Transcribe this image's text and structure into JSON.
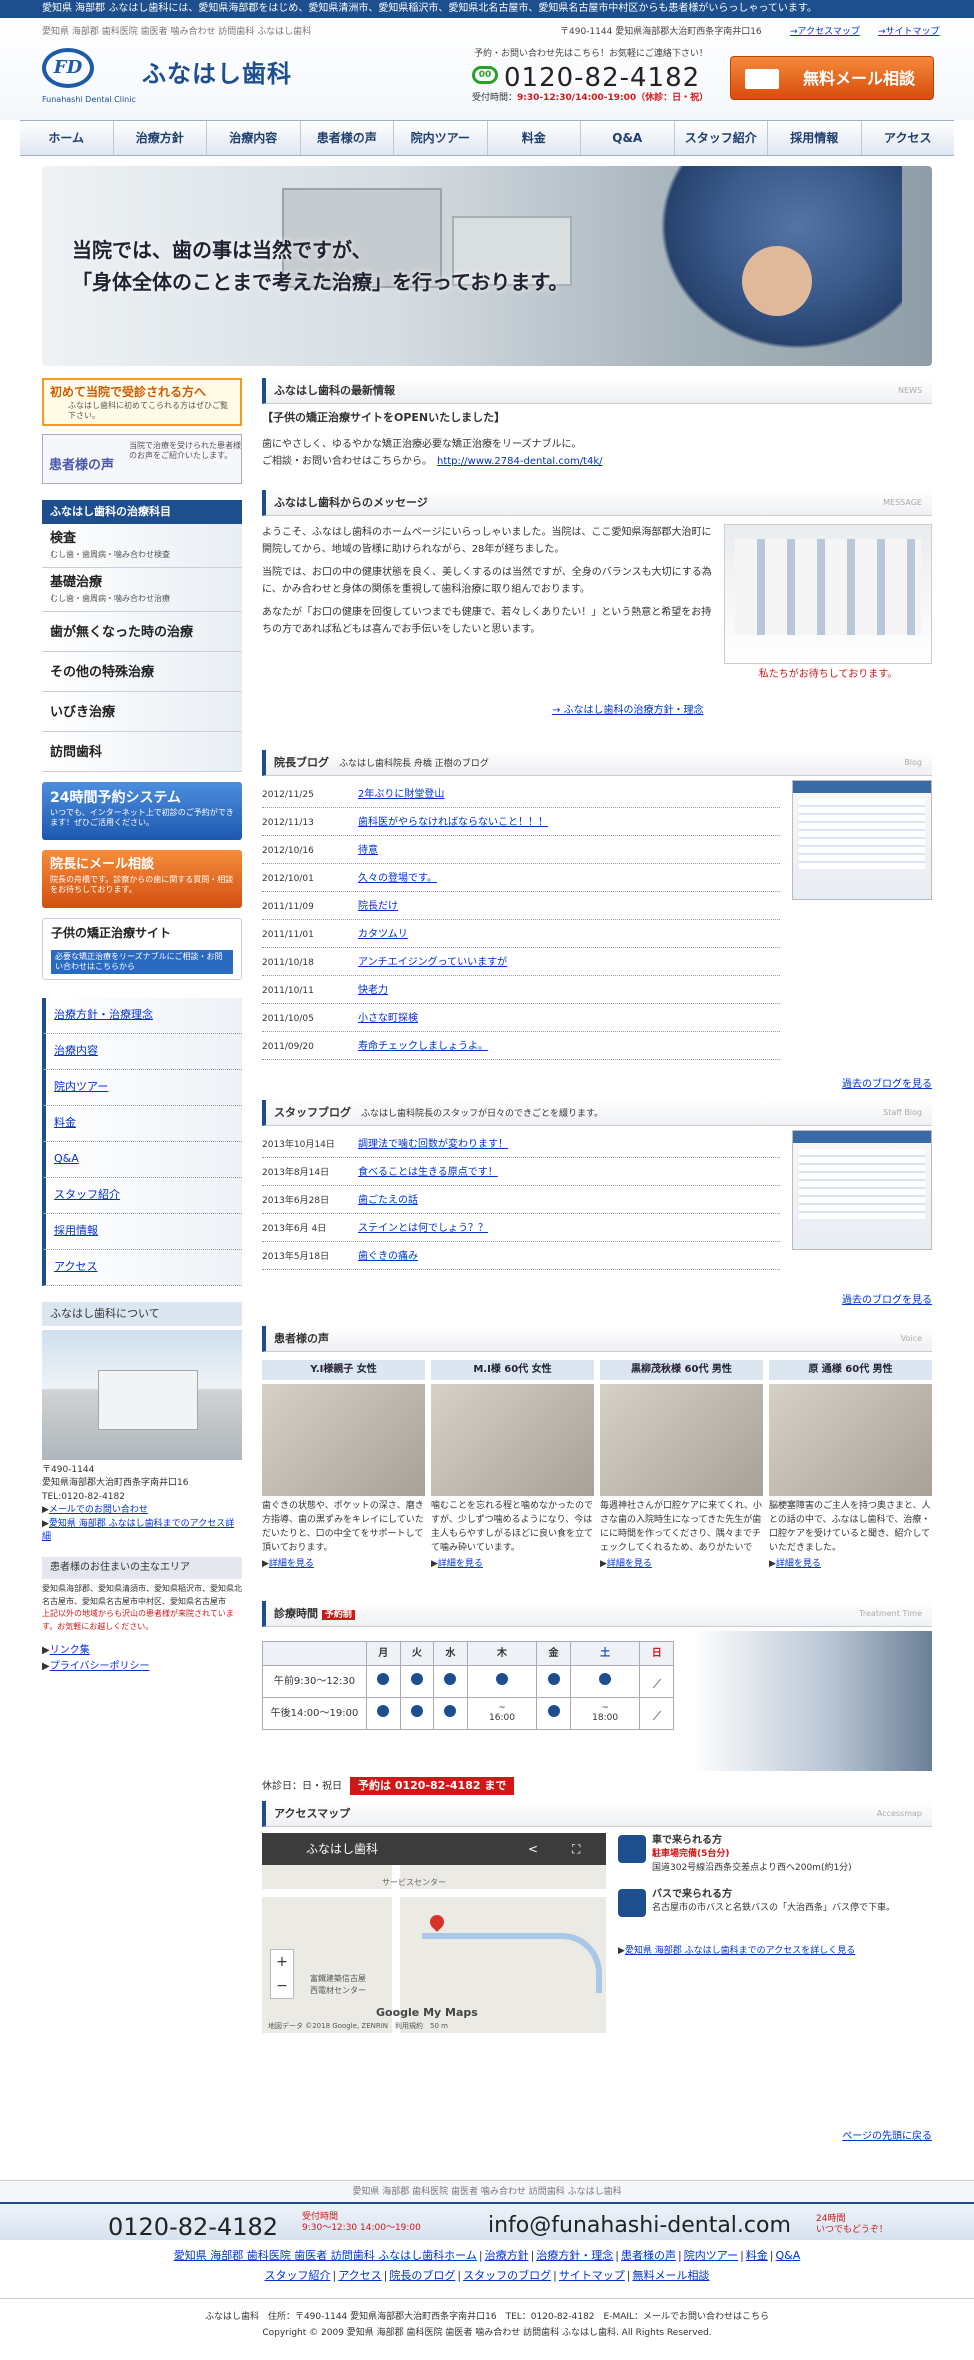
{
  "topbar": "愛知県 海部郡 ふなはし歯科には、愛知県海部郡をはじめ、愛知県清洲市、愛知県稲沢市、愛知県北名古屋市、愛知県名古屋市中村区からも患者様がいらっしゃっています。",
  "header": {
    "sub": "愛知県 海部郡 歯科医院 歯医者 噛み合わせ 訪問歯科 ふなはし歯科",
    "logo_mark": "FD",
    "logo_name": "ふなはし歯科",
    "logo_en": "Funahashi Dental Clinic",
    "address": "〒490-1144 愛知県海部郡大治町西条字南井口16",
    "link_access": "→アクセスマップ",
    "link_sitemap": "→サイトマップ",
    "note": "予約・お問い合わせ先はこちら！お気軽にご連絡下さい！",
    "phone": "0120-82-4182",
    "phone_hours_label": "受付時間：",
    "phone_hours": "9:30-12:30/14:00-19:00（休診：日・祝）",
    "mail_button": "無料メール相談"
  },
  "nav": [
    "ホーム",
    "治療方針",
    "治療内容",
    "患者様の声",
    "院内ツアー",
    "料金",
    "Q&A",
    "スタッフ紹介",
    "採用情報",
    "アクセス"
  ],
  "hero": {
    "line1": "当院では、歯の事は当然ですが、",
    "line2": "「身体全体のことまで考えた治療」を行っております。"
  },
  "side": {
    "first_title": "初めて当院で受診される方へ",
    "first_sub": "ふなはし歯科に初めてこられる方はぜひご覧下さい。",
    "voice_title": "患者様の声",
    "voice_sub": "当院で治療を受けられた患者様のお声をご紹介いたします。",
    "cat_head": "ふなはし歯科の治療科目",
    "cats": [
      {
        "t": "検査",
        "s": "むし歯・歯周病・噛み合わせ検査"
      },
      {
        "t": "基礎治療",
        "s": "むし歯・歯周病・噛み合わせ治療"
      },
      {
        "t": "歯が無くなった時の治療",
        "s": ""
      },
      {
        "t": "その他の特殊治療",
        "s": ""
      },
      {
        "t": "いびき治療",
        "s": ""
      },
      {
        "t": "訪問歯科",
        "s": ""
      }
    ],
    "res_title": "24時間予約システム",
    "res_sub": "いつでも、インターネット上で初診のご予約ができます！ぜひご活用ください。",
    "mail_title": "院長にメール相談",
    "mail_sub": "院長の舟橋です。診察からの歯に関する質問・相談をお待ちしております。",
    "kids_title": "子供の矯正治療サイト",
    "kids_sub": "必要な矯正治療をリーズナブルにご相談・お問い合わせはこちらから",
    "links": [
      "治療方針・治療理念",
      "治療内容",
      "院内ツアー",
      "料金",
      "Q&A",
      "スタッフ紹介",
      "採用情報",
      "アクセス"
    ],
    "about_head": "ふなはし歯科について",
    "about_lines": [
      "〒490-1144",
      "愛知県海部郡大治町西条字南井口16",
      "TEL:0120-82-4182"
    ],
    "about_link1": "メールでのお問い合わせ",
    "about_link2": "愛知県 海部郡 ふなはし歯科までのアクセス詳細",
    "area_head": "患者様のお住まいの主なエリア",
    "area_txt": "愛知県海部郡、愛知県清須市、愛知県稲沢市、愛知県北名古屋市、愛知県名古屋市中村区、愛知県名古屋市",
    "area_red": "上記以外の地域からも沢山の患者様が来院されています。お気軽にお越しください。",
    "link_list": "リンク集",
    "link_privacy": "プライバシーポリシー"
  },
  "news": {
    "head": "ふなはし歯科の最新情報",
    "en": "NEWS",
    "title": "【子供の矯正治療サイトをOPENいたしました】",
    "body1": "歯にやさしく、ゆるやかな矯正治療必要な矯正治療をリーズナブルに。",
    "body2": "ご相談・お問い合わせはこちらから。",
    "url": "http://www.2784-dental.com/t4k/"
  },
  "message": {
    "head": "ふなはし歯科からのメッセージ",
    "en": "MESSAGE",
    "p1": "ようこそ、ふなはし歯科のホームページにいらっしゃいました。当院は、ここ愛知県海部郡大治町に開院してから、地域の皆様に助けられながら、28年が経ちました。",
    "p2": "当院では、お口の中の健康状態を良く、美しくするのは当然ですが、全身のバランスも大切にする為に、かみ合わせと身体の関係を重視して歯科治療に取り組んでおります。",
    "p3": "あなたが「お口の健康を回復していつまでも健康で、若々しくありたい！」という熱意と希望をお持ちの方であれば私どもは喜んでお手伝いをしたいと思います。",
    "caption": "私たちがお待ちしております。",
    "link": "→ ふなはし歯科の治療方針・理念"
  },
  "blog": {
    "head": "院長ブログ",
    "sub": "ふなはし歯科院長 舟橋 正樹のブログ",
    "en": "Blog",
    "rows": [
      {
        "d": "2012/11/25",
        "t": "2年ぶりに財堂登山"
      },
      {
        "d": "2012/11/13",
        "t": "歯科医がやらなければならないこと！！！"
      },
      {
        "d": "2012/10/16",
        "t": "待意"
      },
      {
        "d": "2012/10/01",
        "t": "久々の登場です。"
      },
      {
        "d": "2011/11/09",
        "t": "院長だけ"
      },
      {
        "d": "2011/11/01",
        "t": "カタツムリ"
      },
      {
        "d": "2011/10/18",
        "t": "アンチエイジングっていいますが"
      },
      {
        "d": "2011/10/11",
        "t": "快老力"
      },
      {
        "d": "2011/10/05",
        "t": "小さな町探検"
      },
      {
        "d": "2011/09/20",
        "t": "寿命チェックしましょうよ。"
      }
    ],
    "more": "過去のブログを見る"
  },
  "staff": {
    "head": "スタッフブログ",
    "sub": "ふなはし歯科院長のスタッフが日々のできごとを綴ります。",
    "en": "Staff Blog",
    "rows": [
      {
        "d": "2013年10月14日",
        "t": "調理法で噛む回数が変わります！"
      },
      {
        "d": "2013年8月14日",
        "t": "食べることは生きる原点です！"
      },
      {
        "d": "2013年6月28日",
        "t": "歯ごたえの話"
      },
      {
        "d": "2013年6月 4日",
        "t": "ステインとは何でしょう？？"
      },
      {
        "d": "2013年5月18日",
        "t": "歯ぐきの痛み"
      }
    ],
    "more": "過去のブログを見る"
  },
  "voice": {
    "head": "患者様の声",
    "en": "Voice",
    "items": [
      {
        "n": "Y.I様親子 女性",
        "t": "歯ぐきの状態や、ポケットの深さ、磨き方指導、歯の黒ずみをキレイにしていただいたりと、口の中全てをサポートして頂いております。"
      },
      {
        "n": "M.I様 60代 女性",
        "t": "噛むことを忘れる程と噛めなかったのですが、少しずつ噛めるようになり、今は主人もらやすしがるほどに良い食を立てて噛み砕いています。"
      },
      {
        "n": "黒柳茂秋様 60代 男性",
        "t": "毎週神社さんが口腔ケアに来てくれ、小さな歯の入院時生になってきた先生が歯にに時間を作ってくださり、隅々までチェックしてくれるため、ありがたいです。"
      },
      {
        "n": "原 通様 60代 男性",
        "t": "脳梗塞障害のご主人を持つ奥さまと、人との話の中で、ふなはし歯科で、治療・口腔ケアを受けていると聞き、紹介していただきました。"
      }
    ],
    "more": "詳細を見る"
  },
  "hours": {
    "head": "診療時間",
    "badge": "予約制",
    "en": "Treatment Time",
    "days": [
      "月",
      "火",
      "水",
      "木",
      "金",
      "土",
      "日"
    ],
    "am_label": "午前9:30～12:30",
    "pm_label": "午後14:00～19:00",
    "pm_thu": "16:00",
    "pm_sat": "18:00",
    "note": "休診日：日・祝日",
    "tel": "予約は 0120-82-4182 まで"
  },
  "access": {
    "head": "アクセスマップ",
    "en": "Accessmap",
    "map_title": "ふなはし歯科",
    "map_road": "サービスセンター",
    "map_label": "富鐵建築信古屋\n西電材センター",
    "map_logo": "Google My Maps",
    "map_copy": "地図データ ©2018 Google, ZENRIN　利用規約　50 m",
    "car_t": "車で来られる方",
    "car_red": "駐車場完備(5台分)",
    "car_txt": "国道302号線沿西条交差点より西へ200m(約1分)",
    "bus_t": "バスで来られる方",
    "bus_txt": "名古屋市の市バスと名鉄バスの「大治西条」バス停で下車。",
    "link": "愛知県 海部郡 ふなはし歯科までのアクセスを詳しく見る",
    "pagetop": "ページの先頭に戻る"
  },
  "footer": {
    "kw": "愛知県 海部郡 歯科医院 歯医者 噛み合わせ 訪問歯科 ふなはし歯科",
    "phone": "0120-82-4182",
    "phone_lbl": "受付時間\n9:30～12:30 14:00～19:00",
    "mail": "info@funahashi-dental.com",
    "mail_lbl": "24時間\nいつでもどうぞ！",
    "links": [
      "愛知県 海部郡 歯科医院 歯医者 訪問歯科 ふなはし歯科ホーム",
      "治療方針",
      "治療方針・理念",
      "患者様の声",
      "院内ツアー",
      "料金",
      "Q&A",
      "スタッフ紹介",
      "アクセス",
      "院長のブログ",
      "スタッフのブログ",
      "サイトマップ",
      "無料メール相談"
    ],
    "addr": "ふなはし歯科　住所：〒490-1144 愛知県海部郡大治町西条字南井口16　TEL：0120-82-4182　E-MAIL：メールでお問い合わせはこちら",
    "copy": "Copyright © 2009 愛知県 海部郡 歯科医院 歯医者 噛み合わせ 訪問歯科 ふなはし歯科. All Rights Reserved."
  }
}
